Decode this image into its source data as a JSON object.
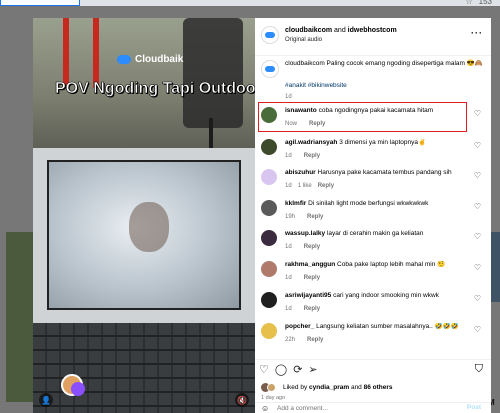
{
  "browser": {
    "badge_count": "153"
  },
  "background": {
    "side_label": "M"
  },
  "media": {
    "brand": "Cloudbaik",
    "overlay_title": "POV Ngoding Tapi Outdoor"
  },
  "header": {
    "user1": "cloudbaikcom",
    "connector": "and",
    "user2": "idwebhostcom",
    "subtitle": "Original audio"
  },
  "caption": {
    "text": "cloudbaikcom Paling cocok emang ngoding disepertiga malam 😎🙈",
    "tags": "#anakit #bikinwebsite",
    "time": "1d"
  },
  "comments": [
    {
      "user": "isnawanto",
      "text": "coba ngodingnya pakai kacamata hitam",
      "time": "Now",
      "likes": "",
      "avatar_color": "#4a6b3a"
    },
    {
      "user": "agil.wadriansyah",
      "text": "3 dimensi ya min laptopnya✌️",
      "time": "1d",
      "likes": "",
      "avatar_color": "#3d4a2c"
    },
    {
      "user": "abiszuhur",
      "text": "Harusnya pake kacamata tembus pandang sih",
      "time": "1d",
      "likes": "1 like",
      "avatar_color": "#d8c6f0"
    },
    {
      "user": "kklmfir",
      "text": "Di sinilah light mode berfungsi wkwkwkwk",
      "time": "19h",
      "likes": "",
      "avatar_color": "#5a5a5a"
    },
    {
      "user": "wassup.lalky",
      "text": "layar di cerahin makin ga keliatan",
      "time": "1d",
      "likes": "",
      "avatar_color": "#3b2b3f"
    },
    {
      "user": "rakhma_anggun",
      "text": "Coba pake laptop lebih mahal min 🤨",
      "time": "1d",
      "likes": "",
      "avatar_color": "#b07a6a"
    },
    {
      "user": "asriwijayanti95",
      "text": "cari yang indoor smooking min wkwk",
      "time": "1d",
      "likes": "",
      "avatar_color": "#1f1f1f"
    },
    {
      "user": "popcher_",
      "text": "Langsung keliatan sumber masalahnya.. 🤣🤣🤣",
      "time": "22h",
      "likes": "",
      "avatar_color": "#e6c04a"
    }
  ],
  "reply_label": "Reply",
  "likes": {
    "prefix": "Liked by",
    "user": "cyndia_pram",
    "middle": "and",
    "others": "86 others"
  },
  "post_date": "1 day ago",
  "add_comment": {
    "placeholder": "Add a comment...",
    "post_label": "Post"
  }
}
